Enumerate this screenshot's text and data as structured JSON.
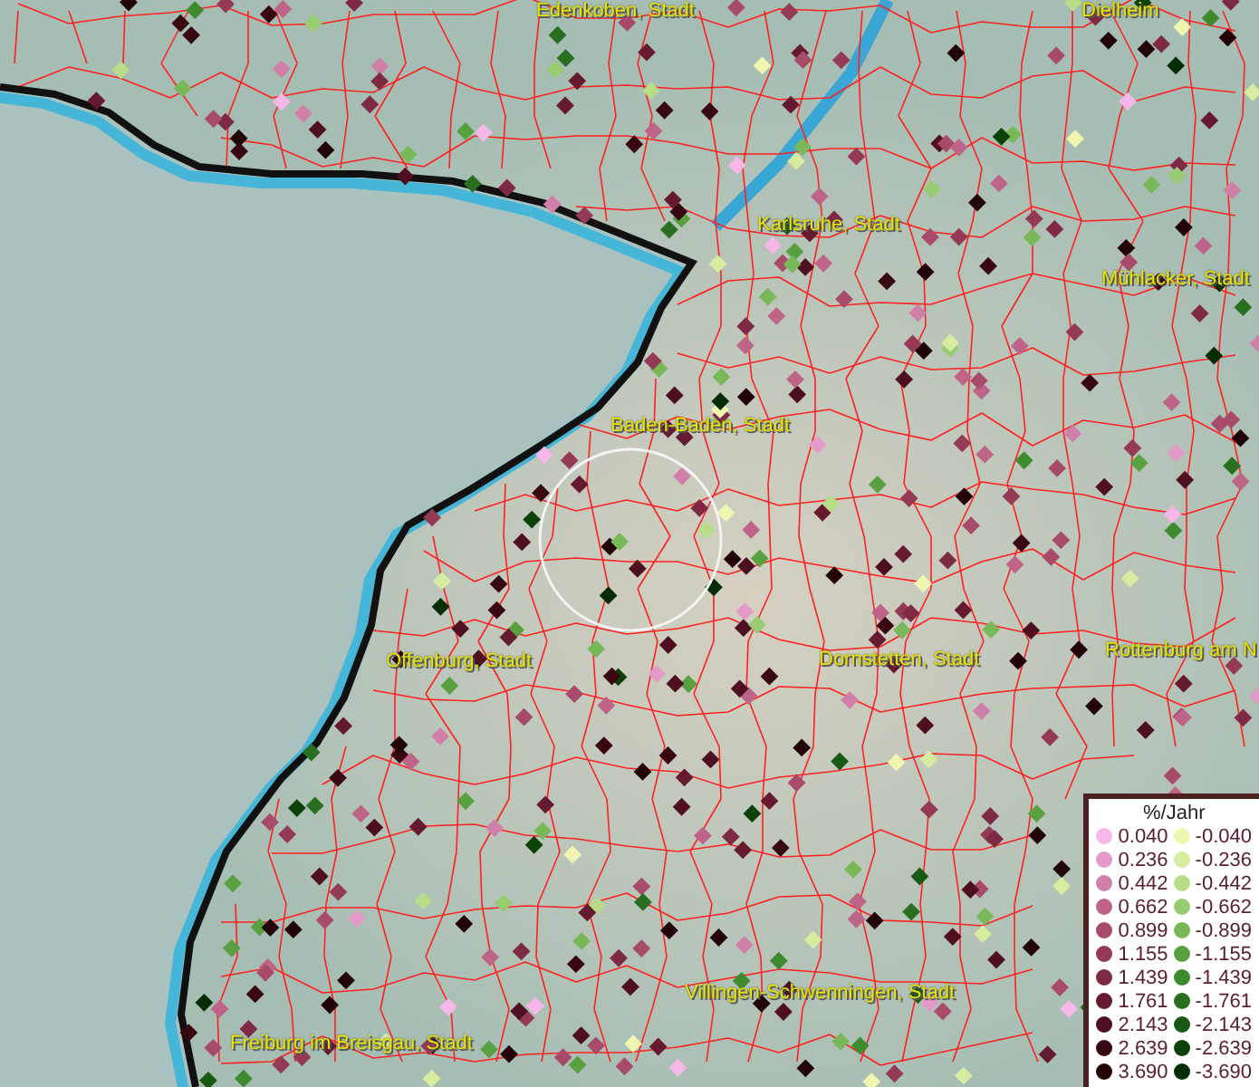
{
  "map": {
    "labels": [
      {
        "text": "Edenkoben, Stadt"
      },
      {
        "text": "Dielheim"
      },
      {
        "text": "Karlsruhe, Stadt"
      },
      {
        "text": "Mühlacker, Stadt"
      },
      {
        "text": "Baden-Baden, Stadt"
      },
      {
        "text": "Offenburg, Stadt"
      },
      {
        "text": "Dornstetten, Stadt"
      },
      {
        "text": "Rottenburg am N"
      },
      {
        "text": "Villingen-Schwenningen, Stadt"
      },
      {
        "text": "Freiburg im Breisgau, Stadt"
      }
    ]
  },
  "legend": {
    "title": "%/Jahr",
    "left": [
      {
        "label": "0.040",
        "color": "#f5b8e8"
      },
      {
        "label": "0.236",
        "color": "#e49ac8"
      },
      {
        "label": "0.442",
        "color": "#d07fa8"
      },
      {
        "label": "0.662",
        "color": "#be6488"
      },
      {
        "label": "0.899",
        "color": "#a84a6a"
      },
      {
        "label": "1.155",
        "color": "#943a55"
      },
      {
        "label": "1.439",
        "color": "#7e2a42"
      },
      {
        "label": "1.761",
        "color": "#661a30"
      },
      {
        "label": "2.143",
        "color": "#4e0f20"
      },
      {
        "label": "2.639",
        "color": "#380712"
      },
      {
        "label": "3.690",
        "color": "#220308"
      }
    ],
    "right": [
      {
        "label": "-0.040",
        "color": "#f0f5b0"
      },
      {
        "label": "-0.236",
        "color": "#d8eca0"
      },
      {
        "label": "-0.442",
        "color": "#b8dc88"
      },
      {
        "label": "-0.662",
        "color": "#98cc70"
      },
      {
        "label": "-0.899",
        "color": "#78b858"
      },
      {
        "label": "-1.155",
        "color": "#58a040"
      },
      {
        "label": "-1.439",
        "color": "#3e8a2e"
      },
      {
        "label": "-1.761",
        "color": "#287020"
      },
      {
        "label": "-2.143",
        "color": "#185a14"
      },
      {
        "label": "-2.639",
        "color": "#0c4208"
      },
      {
        "label": "-3.690",
        "color": "#062c04"
      }
    ]
  }
}
